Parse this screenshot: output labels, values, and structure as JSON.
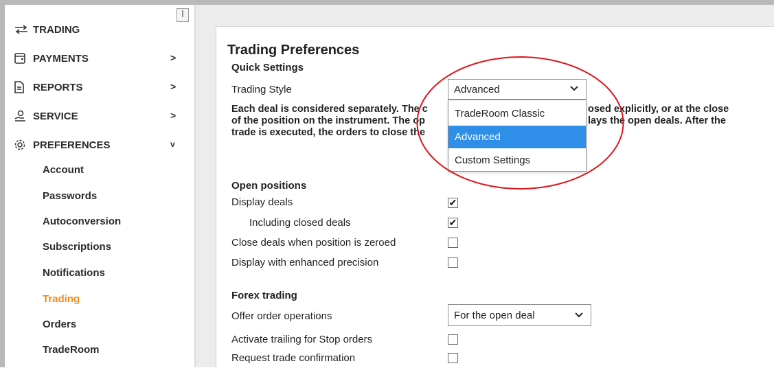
{
  "sidebar": {
    "pin_glyph": "ꟾ",
    "nav": [
      {
        "label": "TRADING",
        "icon": "transfer-arrows-icon",
        "chevron": ""
      },
      {
        "label": "PAYMENTS",
        "icon": "wallet-icon",
        "chevron": ">"
      },
      {
        "label": "REPORTS",
        "icon": "document-icon",
        "chevron": ">"
      },
      {
        "label": "SERVICE",
        "icon": "hand-service-icon",
        "chevron": ">"
      },
      {
        "label": "PREFERENCES",
        "icon": "gear-icon",
        "chevron": "v"
      }
    ],
    "sub": [
      {
        "label": "Account"
      },
      {
        "label": "Passwords"
      },
      {
        "label": "Autoconversion"
      },
      {
        "label": "Subscriptions"
      },
      {
        "label": "Notifications"
      },
      {
        "label": "Trading",
        "active": true
      },
      {
        "label": "Orders"
      },
      {
        "label": "TradeRoom"
      }
    ],
    "active_color": "#f08a1c"
  },
  "main": {
    "title": "Trading Preferences",
    "quick_settings": {
      "heading": "Quick Settings",
      "trading_style_label": "Trading Style",
      "trading_style_value": "Advanced",
      "dropdown_options": [
        "TradeRoom Classic",
        "Advanced",
        "Custom Settings"
      ],
      "selected_option": "Advanced",
      "desc_line1_a": "Each deal is considered separately. The c",
      "desc_line1_b": "osed explicitly, or at the close",
      "desc_line2_a": "of the position on the instrument. The op",
      "desc_line2_b": "lays the open deals. After the",
      "desc_line3_a": "trade is executed, the orders to close the"
    },
    "open_positions": {
      "heading": "Open positions",
      "rows": [
        {
          "label": "Display deals",
          "checked": true
        },
        {
          "label": "Including closed deals",
          "checked": true
        },
        {
          "label": "Close deals when position is zeroed",
          "checked": false
        },
        {
          "label": "Display with enhanced precision",
          "checked": false
        }
      ]
    },
    "forex_trading": {
      "heading": "Forex trading",
      "offer_label": "Offer order operations",
      "offer_value": "For the open deal",
      "rows": [
        {
          "label": "Activate trailing for Stop orders",
          "checked": false
        },
        {
          "label": "Request trade confirmation",
          "checked": false
        }
      ]
    },
    "check_glyph": "✔",
    "highlight_color": "#e0141c",
    "selection_color": "#2e8ee8"
  }
}
